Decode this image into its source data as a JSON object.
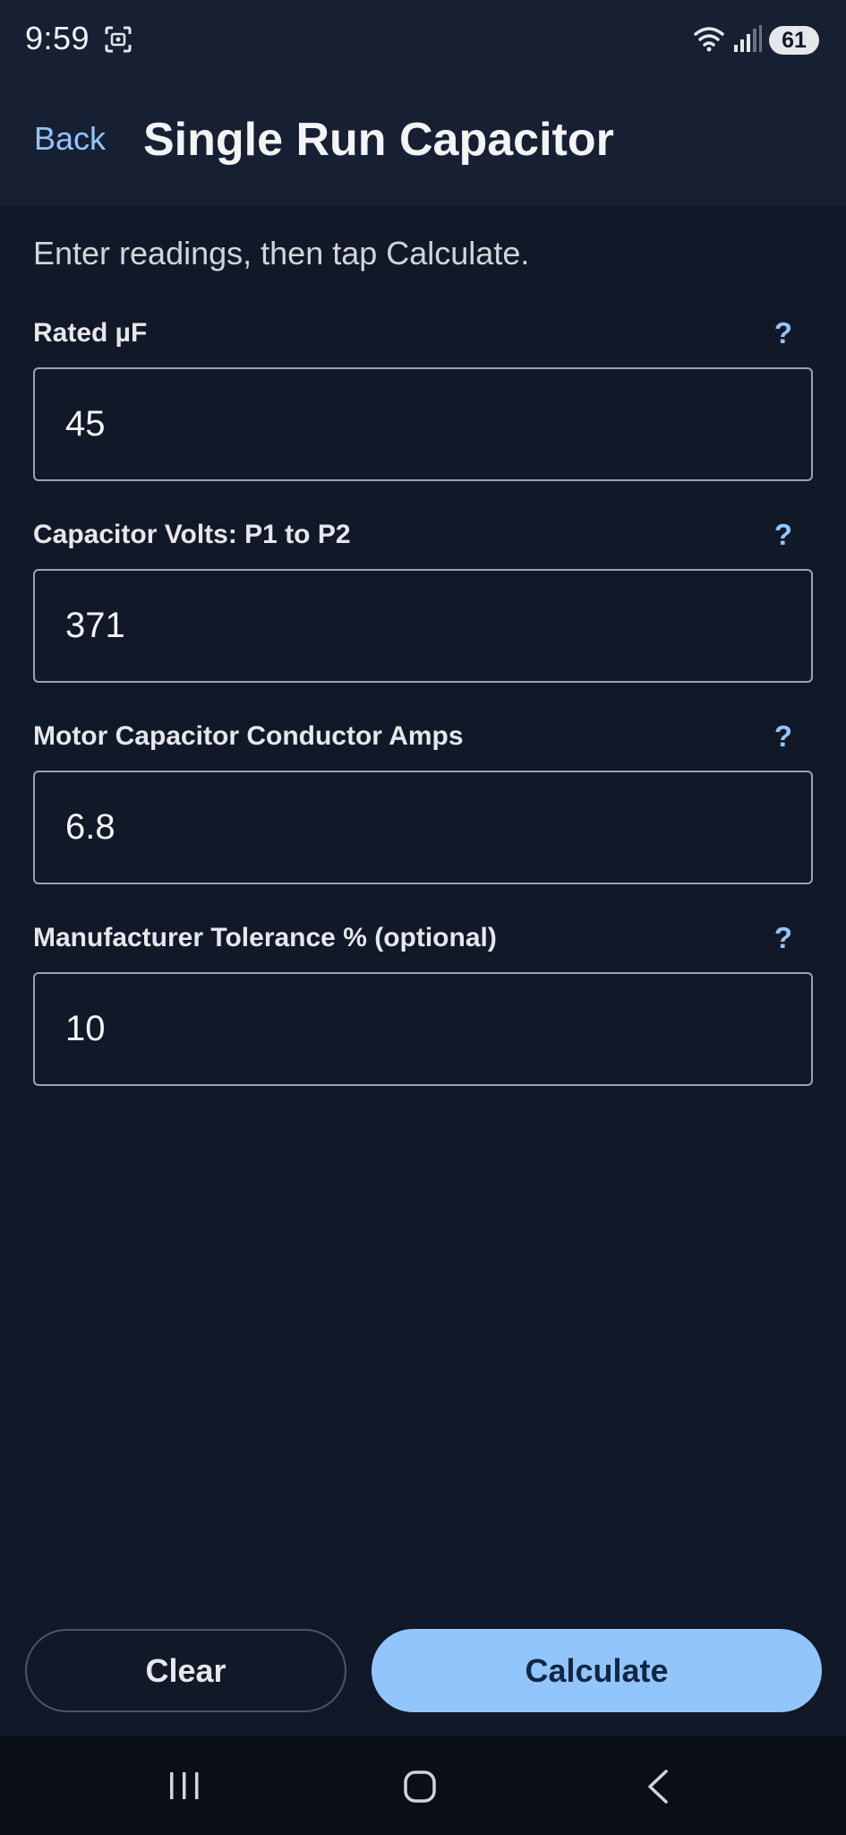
{
  "status_bar": {
    "time": "9:59",
    "battery": "61",
    "icons": [
      "screenshot-icon",
      "wifi-icon",
      "signal-icon"
    ]
  },
  "header": {
    "back_label": "Back",
    "title": "Single Run Capacitor"
  },
  "main": {
    "intro": "Enter readings, then tap Calculate.",
    "help_symbol": "?",
    "fields": [
      {
        "label": "Rated µF",
        "value": "45"
      },
      {
        "label": "Capacitor Volts: P1 to P2",
        "value": "371"
      },
      {
        "label": "Motor Capacitor Conductor Amps",
        "value": "6.8"
      },
      {
        "label": "Manufacturer Tolerance % (optional)",
        "value": "10"
      }
    ]
  },
  "actions": {
    "clear_label": "Clear",
    "calculate_label": "Calculate"
  },
  "nav_bar": {
    "icons": [
      "recents-icon",
      "home-icon",
      "back-icon"
    ]
  },
  "colors": {
    "background": "#111827",
    "header": "#172033",
    "accent": "#93c5fd",
    "text": "#e5e7eb",
    "field_border": "#9ca3af"
  }
}
